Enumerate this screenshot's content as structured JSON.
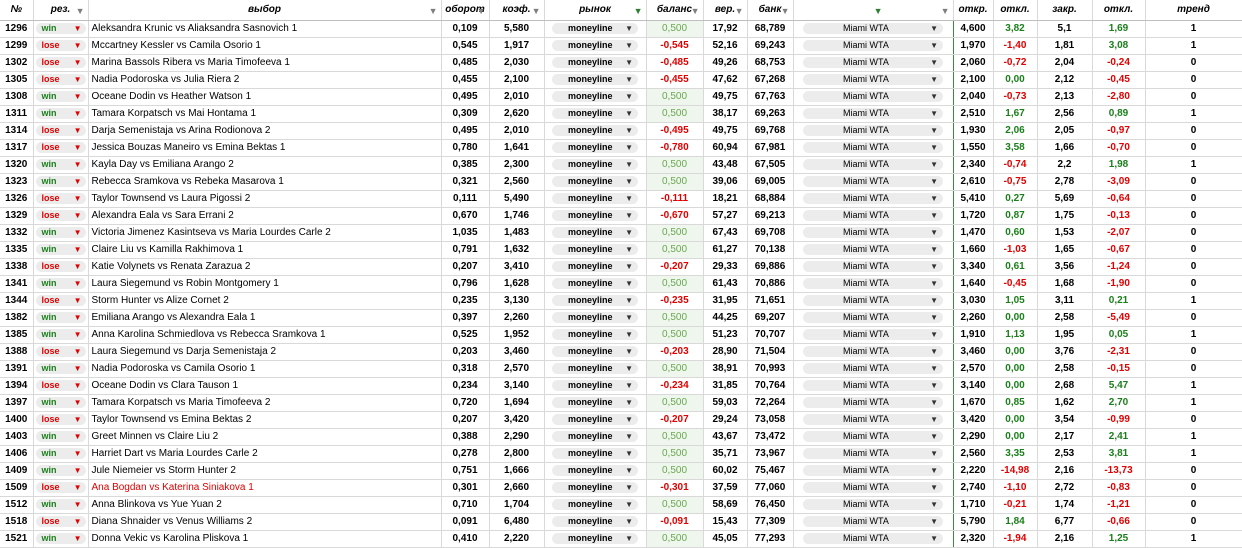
{
  "headers": {
    "num": "№",
    "rez": "рез.",
    "vybor": "выбор",
    "oborot": "оборот",
    "koef": "коэф.",
    "rynok": "рынок",
    "balans": "баланс",
    "ver": "вер.",
    "bank": "банк",
    "tour": "",
    "otkr": "откр.",
    "otkl1": "откл.",
    "zakr": "закр.",
    "otkl2": "откл.",
    "trend": "тренд"
  },
  "colors": {
    "win": "#1a7f1a",
    "lose": "#e00000",
    "grid": "#d9d9d9",
    "pill": "#ececec"
  },
  "rows": [
    {
      "id": "1296",
      "res": "win",
      "sel": "Aleksandra Krunic  vs  Aliaksandra Sasnovich 1",
      "turn": "0,109",
      "koef": "5,580",
      "market": "moneyline",
      "bal": "0,500",
      "ver": "17,92",
      "bank": "68,789",
      "tour": "Miami WTA",
      "otkr": "4,600",
      "o1": "3,82",
      "zakr": "5,1",
      "o2": "1,69",
      "trend": "1"
    },
    {
      "id": "1299",
      "res": "lose",
      "sel": "Mccartney Kessler  vs  Camila Osorio 1",
      "turn": "0,545",
      "koef": "1,917",
      "market": "moneyline",
      "bal": "-0,545",
      "ver": "52,16",
      "bank": "69,243",
      "tour": "Miami WTA",
      "otkr": "1,970",
      "o1": "-1,40",
      "zakr": "1,81",
      "o2": "3,08",
      "trend": "1"
    },
    {
      "id": "1302",
      "res": "lose",
      "sel": "Marina Bassols Ribera  vs  Maria Timofeeva 1",
      "turn": "0,485",
      "koef": "2,030",
      "market": "moneyline",
      "bal": "-0,485",
      "ver": "49,26",
      "bank": "68,753",
      "tour": "Miami WTA",
      "otkr": "2,060",
      "o1": "-0,72",
      "zakr": "2,04",
      "o2": "-0,24",
      "trend": "0"
    },
    {
      "id": "1305",
      "res": "lose",
      "sel": " Nadia Podoroska  vs  Julia Riera 2",
      "turn": "0,455",
      "koef": "2,100",
      "market": "moneyline",
      "bal": "-0,455",
      "ver": "47,62",
      "bank": "67,268",
      "tour": "Miami WTA",
      "otkr": "2,100",
      "o1": "0,00",
      "zakr": "2,12",
      "o2": "-0,45",
      "trend": "0"
    },
    {
      "id": "1308",
      "res": "win",
      "sel": "Oceane Dodin  vs  Heather Watson 1",
      "turn": "0,495",
      "koef": "2,010",
      "market": "moneyline",
      "bal": "0,500",
      "ver": "49,75",
      "bank": "67,763",
      "tour": "Miami WTA",
      "otkr": "2,040",
      "o1": "-0,73",
      "zakr": "2,13",
      "o2": "-2,80",
      "trend": "0"
    },
    {
      "id": "1311",
      "res": "win",
      "sel": "Tamara Korpatsch  vs  Mai Hontama 1",
      "turn": "0,309",
      "koef": "2,620",
      "market": "moneyline",
      "bal": "0,500",
      "ver": "38,17",
      "bank": "69,263",
      "tour": "Miami WTA",
      "otkr": "2,510",
      "o1": "1,67",
      "zakr": "2,56",
      "o2": "0,89",
      "trend": "1"
    },
    {
      "id": "1314",
      "res": "lose",
      "sel": " Darja Semenistaja  vs  Arina Rodionova 2",
      "turn": "0,495",
      "koef": "2,010",
      "market": "moneyline",
      "bal": "-0,495",
      "ver": "49,75",
      "bank": "69,768",
      "tour": "Miami WTA",
      "otkr": "1,930",
      "o1": "2,06",
      "zakr": "2,05",
      "o2": "-0,97",
      "trend": "0"
    },
    {
      "id": "1317",
      "res": "lose",
      "sel": "Jessica Bouzas Maneiro  vs  Emina Bektas 1",
      "turn": "0,780",
      "koef": "1,641",
      "market": "moneyline",
      "bal": "-0,780",
      "ver": "60,94",
      "bank": "67,981",
      "tour": "Miami WTA",
      "otkr": "1,550",
      "o1": "3,58",
      "zakr": "1,66",
      "o2": "-0,70",
      "trend": "0"
    },
    {
      "id": "1320",
      "res": "win",
      "sel": "Kayla Day  vs  Emiliana Arango 2",
      "turn": "0,385",
      "koef": "2,300",
      "market": "moneyline",
      "bal": "0,500",
      "ver": "43,48",
      "bank": "67,505",
      "tour": "Miami WTA",
      "otkr": "2,340",
      "o1": "-0,74",
      "zakr": "2,2",
      "o2": "1,98",
      "trend": "1"
    },
    {
      "id": "1323",
      "res": "win",
      "sel": "Rebecca Sramkova  vs  Rebeka Masarova 1",
      "turn": "0,321",
      "koef": "2,560",
      "market": "moneyline",
      "bal": "0,500",
      "ver": "39,06",
      "bank": "69,005",
      "tour": "Miami WTA",
      "otkr": "2,610",
      "o1": "-0,75",
      "zakr": "2,78",
      "o2": "-3,09",
      "trend": "0"
    },
    {
      "id": "1326",
      "res": "lose",
      "sel": "Taylor Townsend  vs  Laura Pigossi 2",
      "turn": "0,111",
      "koef": "5,490",
      "market": "moneyline",
      "bal": "-0,111",
      "ver": "18,21",
      "bank": "68,884",
      "tour": "Miami WTA",
      "otkr": "5,410",
      "o1": "0,27",
      "zakr": "5,69",
      "o2": "-0,64",
      "trend": "0"
    },
    {
      "id": "1329",
      "res": "lose",
      "sel": "Alexandra Eala  vs  Sara Errani 2",
      "turn": "0,670",
      "koef": "1,746",
      "market": "moneyline",
      "bal": "-0,670",
      "ver": "57,27",
      "bank": "69,213",
      "tour": "Miami WTA",
      "otkr": "1,720",
      "o1": "0,87",
      "zakr": "1,75",
      "o2": "-0,13",
      "trend": "0"
    },
    {
      "id": "1332",
      "res": "win",
      "sel": "Victoria Jimenez Kasintseva  vs  Maria Lourdes Carle 2",
      "turn": "1,035",
      "koef": "1,483",
      "market": "moneyline",
      "bal": "0,500",
      "ver": "67,43",
      "bank": "69,708",
      "tour": "Miami WTA",
      "otkr": "1,470",
      "o1": "0,60",
      "zakr": "1,53",
      "o2": "-2,07",
      "trend": "0"
    },
    {
      "id": "1335",
      "res": "win",
      "sel": " Claire Liu  vs  Kamilla Rakhimova 1",
      "turn": "0,791",
      "koef": "1,632",
      "market": "moneyline",
      "bal": "0,500",
      "ver": "61,27",
      "bank": "70,138",
      "tour": "Miami WTA",
      "otkr": "1,660",
      "o1": "-1,03",
      "zakr": "1,65",
      "o2": "-0,67",
      "trend": "0"
    },
    {
      "id": "1338",
      "res": "lose",
      "sel": "Katie Volynets  vs  Renata Zarazua 2",
      "turn": "0,207",
      "koef": "3,410",
      "market": "moneyline",
      "bal": "-0,207",
      "ver": "29,33",
      "bank": "69,886",
      "tour": "Miami WTA",
      "otkr": "3,340",
      "o1": "0,61",
      "zakr": "3,56",
      "o2": "-1,24",
      "trend": "0"
    },
    {
      "id": "1341",
      "res": "win",
      "sel": " Laura Siegemund  vs  Robin Montgomery 1",
      "turn": "0,796",
      "koef": "1,628",
      "market": "moneyline",
      "bal": "0,500",
      "ver": "61,43",
      "bank": "70,886",
      "tour": "Miami WTA",
      "otkr": "1,640",
      "o1": "-0,45",
      "zakr": "1,68",
      "o2": "-1,90",
      "trend": "0"
    },
    {
      "id": "1344",
      "res": "lose",
      "sel": "Storm Hunter  vs  Alize Cornet 2",
      "turn": "0,235",
      "koef": "3,130",
      "market": "moneyline",
      "bal": "-0,235",
      "ver": "31,95",
      "bank": "71,651",
      "tour": "Miami WTA",
      "otkr": "3,030",
      "o1": "1,05",
      "zakr": "3,11",
      "o2": "0,21",
      "trend": "1"
    },
    {
      "id": "1382",
      "res": "win",
      "sel": "Emiliana Arango  vs  Alexandra Eala 1",
      "turn": "0,397",
      "koef": "2,260",
      "market": "moneyline",
      "bal": "0,500",
      "ver": "44,25",
      "bank": "69,207",
      "tour": "Miami WTA",
      "otkr": "2,260",
      "o1": "0,00",
      "zakr": "2,58",
      "o2": "-5,49",
      "trend": "0"
    },
    {
      "id": "1385",
      "res": "win",
      "sel": "Anna Karolina Schmiedlova  vs  Rebecca Sramkova 1",
      "turn": "0,525",
      "koef": "1,952",
      "market": "moneyline",
      "bal": "0,500",
      "ver": "51,23",
      "bank": "70,707",
      "tour": "Miami WTA",
      "otkr": "1,910",
      "o1": "1,13",
      "zakr": "1,95",
      "o2": "0,05",
      "trend": "1"
    },
    {
      "id": "1388",
      "res": "lose",
      "sel": "Laura Siegemund  vs  Darja Semenistaja 2",
      "turn": "0,203",
      "koef": "3,460",
      "market": "moneyline",
      "bal": "-0,203",
      "ver": "28,90",
      "bank": "71,504",
      "tour": "Miami WTA",
      "otkr": "3,460",
      "o1": "0,00",
      "zakr": "3,76",
      "o2": "-2,31",
      "trend": "0"
    },
    {
      "id": "1391",
      "res": "win",
      "sel": "Nadia Podoroska  vs  Camila Osorio 1",
      "turn": "0,318",
      "koef": "2,570",
      "market": "moneyline",
      "bal": "0,500",
      "ver": "38,91",
      "bank": "70,993",
      "tour": "Miami WTA",
      "otkr": "2,570",
      "o1": "0,00",
      "zakr": "2,58",
      "o2": "-0,15",
      "trend": "0"
    },
    {
      "id": "1394",
      "res": "lose",
      "sel": "Oceane Dodin  vs  Clara Tauson 1",
      "turn": "0,234",
      "koef": "3,140",
      "market": "moneyline",
      "bal": "-0,234",
      "ver": "31,85",
      "bank": "70,764",
      "tour": "Miami WTA",
      "otkr": "3,140",
      "o1": "0,00",
      "zakr": "2,68",
      "o2": "5,47",
      "trend": "1"
    },
    {
      "id": "1397",
      "res": "win",
      "sel": "Tamara Korpatsch  vs  Maria Timofeeva 2",
      "turn": "0,720",
      "koef": "1,694",
      "market": "moneyline",
      "bal": "0,500",
      "ver": "59,03",
      "bank": "72,264",
      "tour": "Miami WTA",
      "otkr": "1,670",
      "o1": "0,85",
      "zakr": "1,62",
      "o2": "2,70",
      "trend": "1"
    },
    {
      "id": "1400",
      "res": "lose",
      "sel": "Taylor Townsend  vs  Emina Bektas 2",
      "turn": "0,207",
      "koef": "3,420",
      "market": "moneyline",
      "bal": "-0,207",
      "ver": "29,24",
      "bank": "73,058",
      "tour": "Miami WTA",
      "otkr": "3,420",
      "o1": "0,00",
      "zakr": "3,54",
      "o2": "-0,99",
      "trend": "0"
    },
    {
      "id": "1403",
      "res": "win",
      "sel": "Greet Minnen  vs  Claire Liu 2",
      "turn": "0,388",
      "koef": "2,290",
      "market": "moneyline",
      "bal": "0,500",
      "ver": "43,67",
      "bank": "73,472",
      "tour": "Miami WTA",
      "otkr": "2,290",
      "o1": "0,00",
      "zakr": "2,17",
      "o2": "2,41",
      "trend": "1"
    },
    {
      "id": "1406",
      "res": "win",
      "sel": "Harriet Dart  vs  Maria Lourdes Carle 2",
      "turn": "0,278",
      "koef": "2,800",
      "market": "moneyline",
      "bal": "0,500",
      "ver": "35,71",
      "bank": "73,967",
      "tour": "Miami WTA",
      "otkr": "2,560",
      "o1": "3,35",
      "zakr": "2,53",
      "o2": "3,81",
      "trend": "1"
    },
    {
      "id": "1409",
      "res": "win",
      "sel": "Jule Niemeier  vs  Storm Hunter 2",
      "turn": "0,751",
      "koef": "1,666",
      "market": "moneyline",
      "bal": "0,500",
      "ver": "60,02",
      "bank": "75,467",
      "tour": "Miami WTA",
      "otkr": "2,220",
      "o1": "-14,98",
      "zakr": "2,16",
      "o2": "-13,73",
      "trend": "0"
    },
    {
      "id": "1509",
      "res": "lose",
      "sel": "Ana Bogdan  vs  Katerina Siniakova 1",
      "sel_red": true,
      "turn": "0,301",
      "koef": "2,660",
      "market": "moneyline",
      "bal": "-0,301",
      "ver": "37,59",
      "bank": "77,060",
      "tour": "Miami WTA",
      "otkr": "2,740",
      "o1": "-1,10",
      "zakr": "2,72",
      "o2": "-0,83",
      "trend": "0"
    },
    {
      "id": "1512",
      "res": "win",
      "sel": "Anna Blinkova  vs  Yue Yuan 2",
      "turn": "0,710",
      "koef": "1,704",
      "market": "moneyline",
      "bal": "0,500",
      "ver": "58,69",
      "bank": "76,450",
      "tour": "Miami WTA",
      "otkr": "1,710",
      "o1": "-0,21",
      "zakr": "1,74",
      "o2": "-1,21",
      "trend": "0"
    },
    {
      "id": "1518",
      "res": "lose",
      "sel": "Diana Shnaider  vs  Venus Williams 2",
      "turn": "0,091",
      "koef": "6,480",
      "market": "moneyline",
      "bal": "-0,091",
      "ver": "15,43",
      "bank": "77,309",
      "tour": "Miami WTA",
      "otkr": "5,790",
      "o1": "1,84",
      "zakr": "6,77",
      "o2": "-0,66",
      "trend": "0"
    },
    {
      "id": "1521",
      "res": "win",
      "sel": "Donna Vekic  vs  Karolina Pliskova 1",
      "turn": "0,410",
      "koef": "2,220",
      "market": "moneyline",
      "bal": "0,500",
      "ver": "45,05",
      "bank": "77,293",
      "tour": "Miami WTA",
      "otkr": "2,320",
      "o1": "-1,94",
      "zakr": "2,16",
      "o2": "1,25",
      "trend": "1"
    }
  ]
}
